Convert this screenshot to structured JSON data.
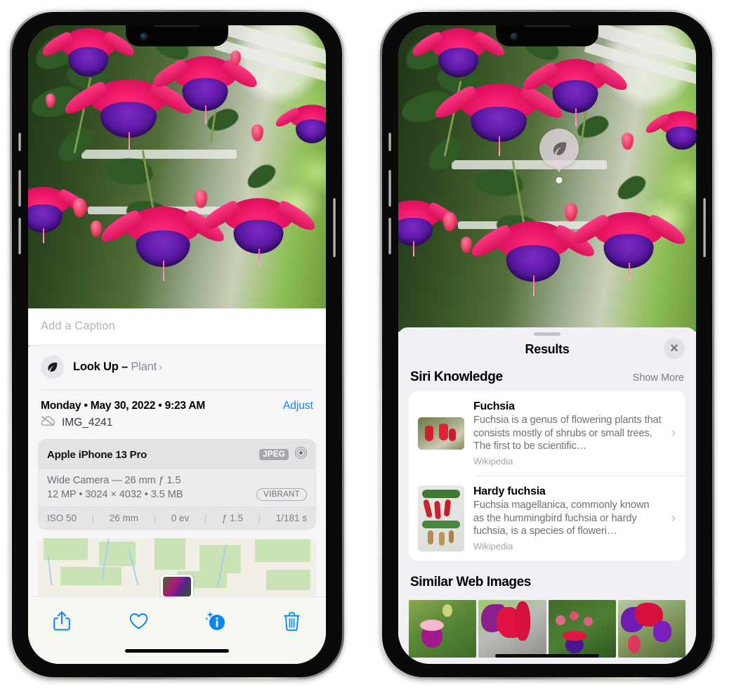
{
  "left_phone": {
    "photo": {
      "alt": "fuchsia-flowers-photo"
    },
    "caption": {
      "placeholder": "Add a Caption",
      "value": ""
    },
    "lookup": {
      "icon": "leaf-icon",
      "label": "Look Up – ",
      "subject": "Plant",
      "chevron": "›"
    },
    "metadata": {
      "date": "Monday • May 30, 2022 • 9:23 AM",
      "adjust_label": "Adjust",
      "cloud_icon": "cloud-slash-icon",
      "filename": "IMG_4241"
    },
    "camera_card": {
      "device": "Apple iPhone 13 Pro",
      "format_badge": "JPEG",
      "aperture_icon": "aperture-icon",
      "lens_line": "Wide Camera — 26 mm ƒ 1.5",
      "size_line": "12 MP • 3024 × 4032 • 3.5 MB",
      "style_badge": "VIBRANT",
      "exif": [
        "ISO 50",
        "26 mm",
        "0 ev",
        "ƒ 1.5",
        "1/181 s"
      ]
    },
    "map": {
      "name": "map-preview",
      "pin": "photo-pin-thumbnail"
    },
    "toolbar": [
      {
        "name": "share-button",
        "icon": "share-icon"
      },
      {
        "name": "favorite-button",
        "icon": "heart-icon"
      },
      {
        "name": "info-button",
        "icon": "info-sparkle-icon"
      },
      {
        "name": "delete-button",
        "icon": "trash-icon"
      }
    ]
  },
  "right_phone": {
    "photo_badge": {
      "icon": "leaf-icon",
      "name": "visual-lookup-badge"
    },
    "sheet": {
      "grabber": "drag-handle",
      "title": "Results",
      "close_icon": "✕"
    },
    "siri_knowledge": {
      "heading": "Siri Knowledge",
      "show_more": "Show More",
      "items": [
        {
          "title": "Fuchsia",
          "description": "Fuchsia is a genus of flowering plants that consists mostly of shrubs or small trees. The first to be scientific…",
          "source": "Wikipedia",
          "chevron": "›"
        },
        {
          "title": "Hardy fuchsia",
          "description": "Fuchsia magellanica, commonly known as the hummingbird fuchsia or hardy fuchsia, is a species of floweri…",
          "source": "Wikipedia",
          "chevron": "›"
        }
      ]
    },
    "similar_web_images": {
      "heading": "Similar Web Images",
      "thumbnails": [
        {
          "name": "web-image-1"
        },
        {
          "name": "web-image-2"
        },
        {
          "name": "web-image-3"
        },
        {
          "name": "web-image-4"
        }
      ]
    }
  },
  "colors": {
    "accent_blue": "#0a84ff",
    "sheet_bg": "#f1f1f5",
    "card_bg": "#ffffff",
    "secondary_text": "#6f6f75",
    "toolbar_bg": "#f6f7f1"
  }
}
